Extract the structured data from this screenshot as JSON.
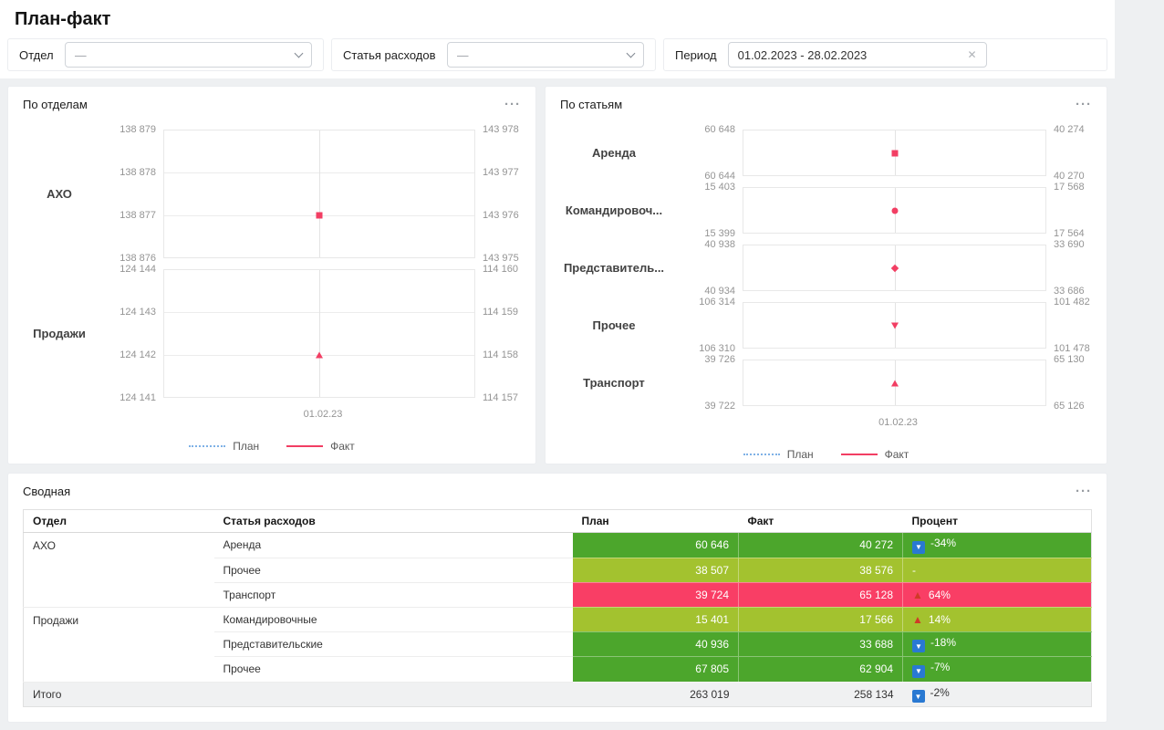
{
  "app": {
    "title": "План-факт"
  },
  "icons": {
    "ellipsis": "···",
    "clear": "✕",
    "trend_up": "▲",
    "trend_down": "▼"
  },
  "colors": {
    "fact": "#f23e63",
    "plan": "#7fb1e6",
    "green": "#4ca62c",
    "olive": "#a3c22f",
    "red": "#f93e65",
    "badge_down_bg": "#2979d2",
    "badge_up": "#cf3a27"
  },
  "filters": {
    "department": {
      "label": "Отдел",
      "value": "—"
    },
    "expense_item": {
      "label": "Статья расходов",
      "value": "—"
    },
    "period": {
      "label": "Период",
      "value": "01.02.2023 - 28.02.2023"
    }
  },
  "chart_data": [
    {
      "id": "by-department",
      "type": "scatter",
      "title": "По отделам",
      "x": [
        "01.02.23"
      ],
      "legend": {
        "plan": "План",
        "fact": "Факт"
      },
      "rows": [
        {
          "category": "АХО",
          "ticks_left": [
            "138 879",
            "138 878",
            "138 877",
            "138 876"
          ],
          "ticks_right": [
            "143 978",
            "143 977",
            "143 976",
            "143 975"
          ],
          "marker": "square",
          "marker_y_pct": 66.7,
          "plan_value": 138877,
          "fact_value": 143976
        },
        {
          "category": "Продажи",
          "ticks_left": [
            "124 144",
            "124 143",
            "124 142",
            "124 141"
          ],
          "ticks_right": [
            "114 160",
            "114 159",
            "114 158",
            "114 157"
          ],
          "marker": "triangle-up",
          "marker_y_pct": 66.7,
          "plan_value": 124142,
          "fact_value": 114158
        }
      ]
    },
    {
      "id": "by-expense-item",
      "type": "scatter",
      "title": "По статьям",
      "x": [
        "01.02.23"
      ],
      "legend": {
        "plan": "План",
        "fact": "Факт"
      },
      "rows": [
        {
          "category": "Аренда",
          "ticks_left": [
            "60 648",
            "60 644"
          ],
          "ticks_right": [
            "40 274",
            "40 270"
          ],
          "marker": "square",
          "marker_y_pct": 50,
          "plan_value": 60646,
          "fact_value": 40272
        },
        {
          "category": "Командировоч...",
          "ticks_left": [
            "15 403",
            "15 399"
          ],
          "ticks_right": [
            "17 568",
            "17 564"
          ],
          "marker": "circle",
          "marker_y_pct": 50,
          "plan_value": 15401,
          "fact_value": 17566
        },
        {
          "category": "Представитель...",
          "ticks_left": [
            "40 938",
            "40 934"
          ],
          "ticks_right": [
            "33 690",
            "33 686"
          ],
          "marker": "diamond",
          "marker_y_pct": 50,
          "plan_value": 40936,
          "fact_value": 33688
        },
        {
          "category": "Прочее",
          "ticks_left": [
            "106 314",
            "106 310"
          ],
          "ticks_right": [
            "101 482",
            "101 478"
          ],
          "marker": "triangle-down",
          "marker_y_pct": 50,
          "plan_value": 106312,
          "fact_value": 101480
        },
        {
          "category": "Транспорт",
          "ticks_left": [
            "39 726",
            "39 722"
          ],
          "ticks_right": [
            "65 130",
            "65 126"
          ],
          "marker": "triangle-up",
          "marker_y_pct": 50,
          "plan_value": 39724,
          "fact_value": 65128
        }
      ]
    }
  ],
  "summary": {
    "title": "Сводная",
    "columns": [
      "Отдел",
      "Статья расходов",
      "План",
      "Факт",
      "Процент"
    ],
    "rows": [
      {
        "department": "АХО",
        "dept_span": 3,
        "item": "Аренда",
        "plan": "60 646",
        "fact": "40 272",
        "percent": "-34%",
        "trend": "down",
        "tone": "green"
      },
      {
        "item": "Прочее",
        "plan": "38 507",
        "fact": "38 576",
        "percent": "-",
        "trend": "flat",
        "tone": "olive"
      },
      {
        "item": "Транспорт",
        "plan": "39 724",
        "fact": "65 128",
        "percent": "64%",
        "trend": "up",
        "tone": "red"
      },
      {
        "department": "Продажи",
        "dept_span": 3,
        "item": "Командировочные",
        "plan": "15 401",
        "fact": "17 566",
        "percent": "14%",
        "trend": "up",
        "tone": "olive"
      },
      {
        "item": "Представительские",
        "plan": "40 936",
        "fact": "33 688",
        "percent": "-18%",
        "trend": "down",
        "tone": "green"
      },
      {
        "item": "Прочее",
        "plan": "67 805",
        "fact": "62 904",
        "percent": "-7%",
        "trend": "down",
        "tone": "green"
      }
    ],
    "total_row": {
      "label": "Итого",
      "plan": "263 019",
      "fact": "258 134",
      "percent": "-2%",
      "trend": "down"
    }
  }
}
